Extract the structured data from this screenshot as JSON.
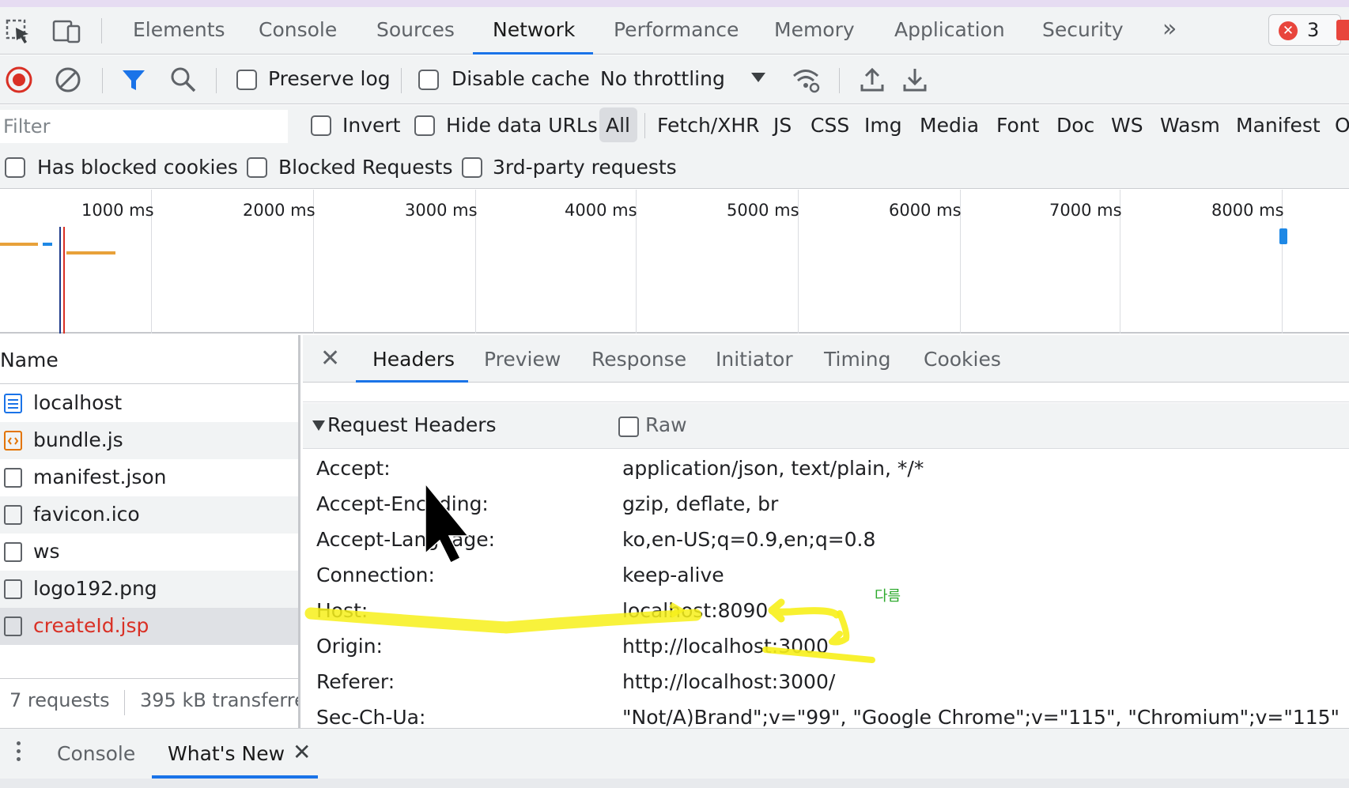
{
  "main_tabs": [
    "Elements",
    "Console",
    "Sources",
    "Network",
    "Performance",
    "Memory",
    "Application",
    "Security"
  ],
  "active_main_tab": "Network",
  "more_tabs_label": "»",
  "error_count": "3",
  "toolbar": {
    "preserve_log": "Preserve log",
    "disable_cache": "Disable cache",
    "throttling": "No throttling"
  },
  "filter": {
    "placeholder": "Filter",
    "invert": "Invert",
    "hide_data_urls": "Hide data URLs",
    "types": [
      "All",
      "Fetch/XHR",
      "JS",
      "CSS",
      "Img",
      "Media",
      "Font",
      "Doc",
      "WS",
      "Wasm",
      "Manifest",
      "O"
    ],
    "has_blocked_cookies": "Has blocked cookies",
    "blocked_requests": "Blocked Requests",
    "third_party": "3rd-party requests"
  },
  "timeline": {
    "ticks": [
      "1000 ms",
      "2000 ms",
      "3000 ms",
      "4000 ms",
      "5000 ms",
      "6000 ms",
      "7000 ms",
      "8000 ms"
    ]
  },
  "request_list": {
    "header": "Name",
    "items": [
      {
        "name": "localhost",
        "icon": "document-icon"
      },
      {
        "name": "bundle.js",
        "icon": "script-icon"
      },
      {
        "name": "manifest.json",
        "icon": "file-icon"
      },
      {
        "name": "favicon.ico",
        "icon": "file-icon"
      },
      {
        "name": "ws",
        "icon": "file-icon"
      },
      {
        "name": "logo192.png",
        "icon": "file-icon"
      },
      {
        "name": "createId.jsp",
        "icon": "file-icon",
        "error": true
      }
    ],
    "requests_count": "7 requests",
    "transferred": "395 kB transferre"
  },
  "detail": {
    "tabs": [
      "Headers",
      "Preview",
      "Response",
      "Initiator",
      "Timing",
      "Cookies"
    ],
    "active_tab": "Headers",
    "section_title": "Request Headers",
    "raw_label": "Raw",
    "headers": [
      {
        "key": "Accept:",
        "value": "application/json, text/plain, */*"
      },
      {
        "key": "Accept-Encoding:",
        "value": "gzip, deflate, br"
      },
      {
        "key": "Accept-Language:",
        "value": "ko,en-US;q=0.9,en;q=0.8"
      },
      {
        "key": "Connection:",
        "value": "keep-alive"
      },
      {
        "key": "Host:",
        "value": "localhost:8090"
      },
      {
        "key": "Origin:",
        "value": "http://localhost:3000"
      },
      {
        "key": "Referer:",
        "value": "http://localhost:3000/"
      },
      {
        "key": "Sec-Ch-Ua:",
        "value": "\"Not/A)Brand\";v=\"99\", \"Google Chrome\";v=\"115\", \"Chromium\";v=\"115\""
      }
    ]
  },
  "drawer": {
    "tabs": [
      "Console",
      "What's New"
    ],
    "active_tab": "What's New"
  },
  "annotation": {
    "note": "다름",
    "highlight_color": "#f7f01a",
    "note_color": "#2eaa2e"
  },
  "colors": {
    "accent": "#1a73e8",
    "record_red": "#d93025",
    "error_red": "#e8453c",
    "filter_blue": "#1a73e8"
  }
}
